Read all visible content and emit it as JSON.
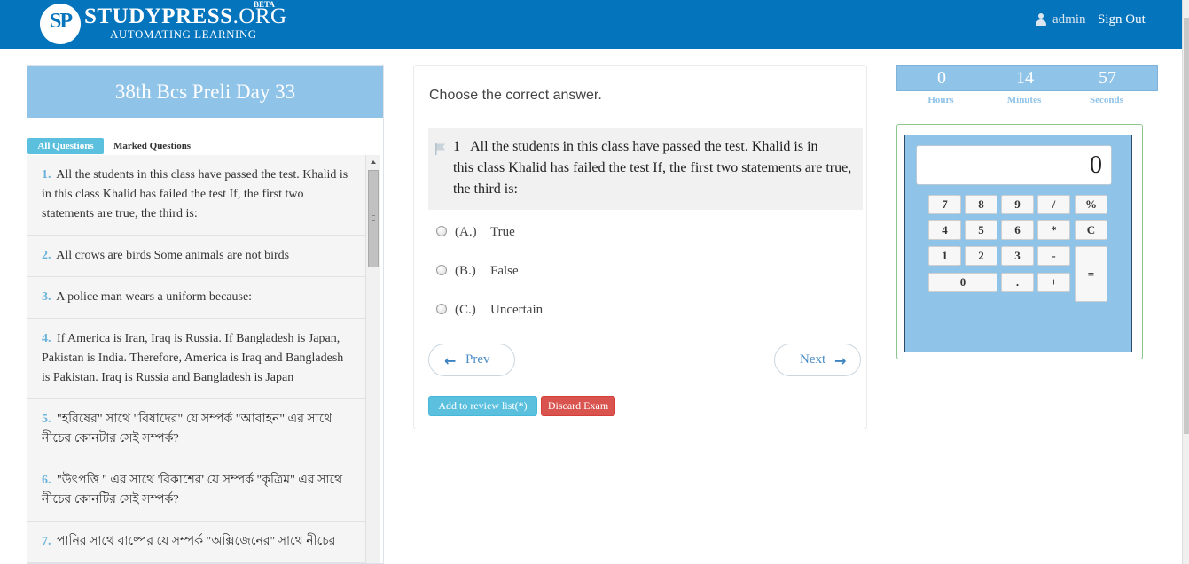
{
  "header": {
    "logo_mark": "SP",
    "logo_name": "STUDYPRESS",
    "logo_domain": ".ORG",
    "logo_badge": "BETA",
    "logo_tagline": "AUTOMATING LEARNING",
    "user_name": "admin",
    "sign_out_label": "Sign Out",
    "background_color": "#0474bd"
  },
  "sidebar": {
    "title": "38th Bcs Preli Day 33",
    "tabs": [
      {
        "label": "All Questions",
        "active": true
      },
      {
        "label": "Marked Questions",
        "active": false
      }
    ],
    "questions": [
      {
        "number": "1.",
        "text": "All the students in this class have passed the test. Khalid is in this class Khalid has failed the test If, the first two statements are true, the third is:"
      },
      {
        "number": "2.",
        "text": "All crows are birds Some animals are not birds"
      },
      {
        "number": "3.",
        "text": "A police man wears a uniform because:"
      },
      {
        "number": "4.",
        "text": "If America is Iran, Iraq is Russia. If Bangladesh is Japan, Pakistan is India. Therefore,   America is Iraq and Bangladesh is Pakistan. Iraq is Russia and Bangladesh is Japan"
      },
      {
        "number": "5.",
        "text": "\"হরিষের\" সাথে \"বিষাদের\" যে সম্পর্ক \"আবাহন\" এর সাথে নীচের কোনটার সেই সম্পর্ক?"
      },
      {
        "number": "6.",
        "text": "\"উৎপত্তি \" এর সাথে 'বিকাশের' যে সম্পর্ক \"কৃত্রিম\"  এর সাথে নীচের কোনটির সেই সম্পর্ক?"
      },
      {
        "number": "7.",
        "text": "পানির সাথে বাষ্পের যে সম্পর্ক \"অক্সিজেনের\" সাথে নীচের"
      }
    ]
  },
  "question": {
    "instruction": "Choose the correct answer.",
    "number": "1",
    "text_first": "All the students in this class have passed the test. Khalid is in",
    "text_rest": "this class Khalid has failed the test If, the first two statements are true, the third is:",
    "options": [
      {
        "label": "(A.)",
        "text": "True",
        "selected": false
      },
      {
        "label": "(B.)",
        "text": "False",
        "selected": false
      },
      {
        "label": "(C.)",
        "text": "Uncertain",
        "selected": false
      }
    ],
    "prev_label": "Prev",
    "next_label": "Next",
    "review_label": "Add to review list(*)",
    "discard_label": "Discard Exam"
  },
  "timer": {
    "hours": "0",
    "minutes": "14",
    "seconds": "57",
    "hours_label": "Hours",
    "minutes_label": "Minutes",
    "seconds_label": "Seconds"
  },
  "calculator": {
    "display": "0",
    "keys": [
      "7",
      "8",
      "9",
      "/",
      "%",
      "4",
      "5",
      "6",
      "*",
      "C",
      "1",
      "2",
      "3",
      "-",
      "0",
      ".",
      "+",
      "="
    ]
  }
}
